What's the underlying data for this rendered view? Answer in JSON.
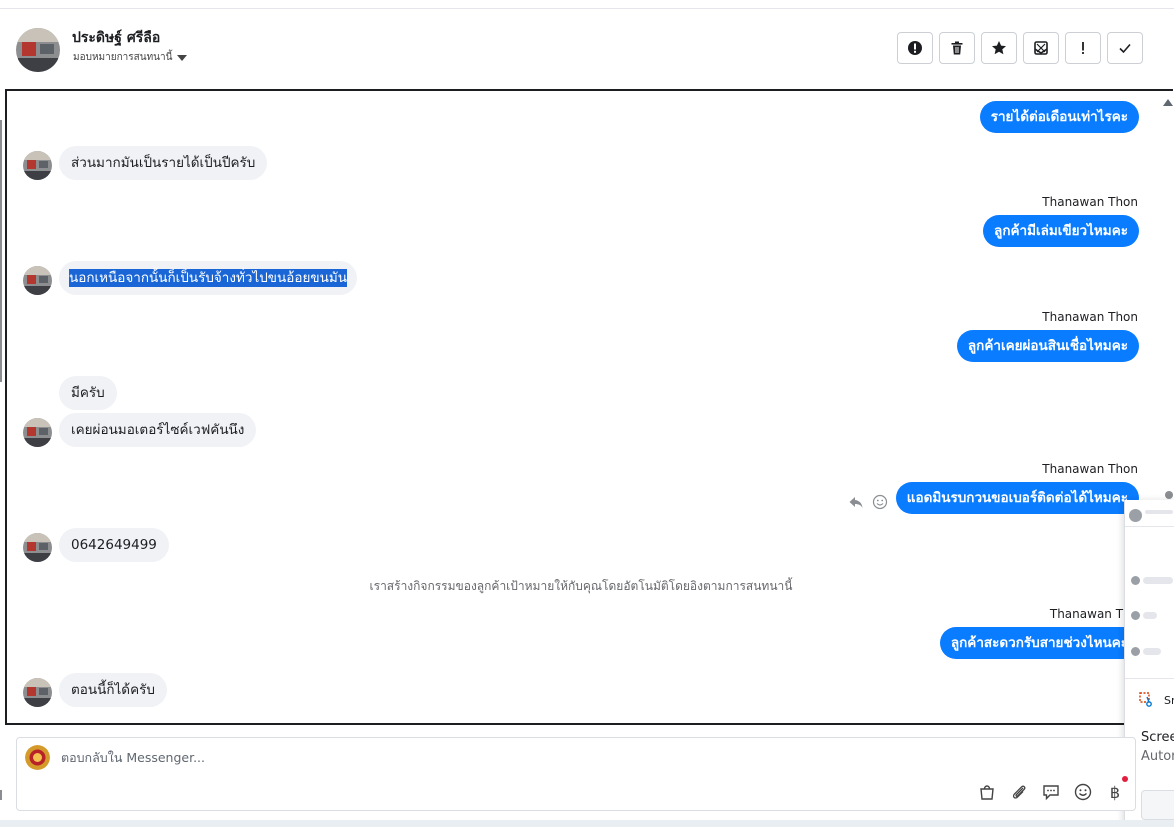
{
  "header": {
    "contact_name": "ประดิษฐ์ ศรีลือ",
    "assign_label": "มอบหมายการสนทนานี้"
  },
  "toolbar": {
    "buttons": [
      {
        "icon": "alert-circle-icon",
        "label": "Mark as spam"
      },
      {
        "icon": "trash-icon",
        "label": "Delete"
      },
      {
        "icon": "star-icon",
        "label": "Star"
      },
      {
        "icon": "mark-unread-icon",
        "label": "Mark unread"
      },
      {
        "icon": "exclamation-icon",
        "label": "Follow up"
      },
      {
        "icon": "check-icon",
        "label": "Done"
      }
    ]
  },
  "conversation": {
    "messages": [
      {
        "dir": "out",
        "text": "รายได้ต่อเดือนเท่าไรคะ"
      },
      {
        "dir": "in",
        "text": "ส่วนมากมันเป็นรายได้เป็นปีครับ"
      },
      {
        "dir": "out",
        "sender": "Thanawan Thon",
        "text": "ลูกค้ามีเล่มเขียวไหมคะ"
      },
      {
        "dir": "in",
        "text": "นอกเหนือจากนั้นก็เป็นรับจ้างทั่วไปขนอ้อยขนมัน",
        "selected": true
      },
      {
        "dir": "out",
        "sender": "Thanawan Thon",
        "text": "ลูกค้าเคยผ่อนสินเชื่อไหมคะ"
      },
      {
        "dir": "in",
        "text": "มีครับ"
      },
      {
        "dir": "in",
        "text": "เคยผ่อนมอเตอร์ไซค์เวฟคันนึง"
      },
      {
        "dir": "out",
        "sender": "Thanawan Thon",
        "text": "แอดมินรบกวนขอเบอร์ติดต่อได้ไหมคะ"
      },
      {
        "dir": "in",
        "text": "0642649499"
      },
      {
        "dir": "system",
        "text": "เราสร้างกิจกรรมของลูกค้าเป้าหมายให้กับคุณโดยอัตโนมัติโดยอิงตามการสนทนานี้"
      },
      {
        "dir": "out",
        "sender": "Thanawan Tho",
        "text": "ลูกค้าสะดวกรับสายช่วงไหนคะ"
      },
      {
        "dir": "in",
        "text": "ตอนนี้ก็ได้ครับ"
      }
    ]
  },
  "composer": {
    "placeholder": "ตอบกลับใน Messenger...",
    "tools": [
      "bag-icon",
      "paperclip-icon",
      "saved-reply-icon",
      "emoji-icon",
      "baht-icon"
    ]
  },
  "overlay": {
    "title": "Sn",
    "line1": "Scree",
    "line2": "Autor"
  },
  "colors": {
    "outgoing_bubble": "#0a7cff",
    "incoming_bubble": "#f0f2f5",
    "selection": "#1a66d6"
  }
}
